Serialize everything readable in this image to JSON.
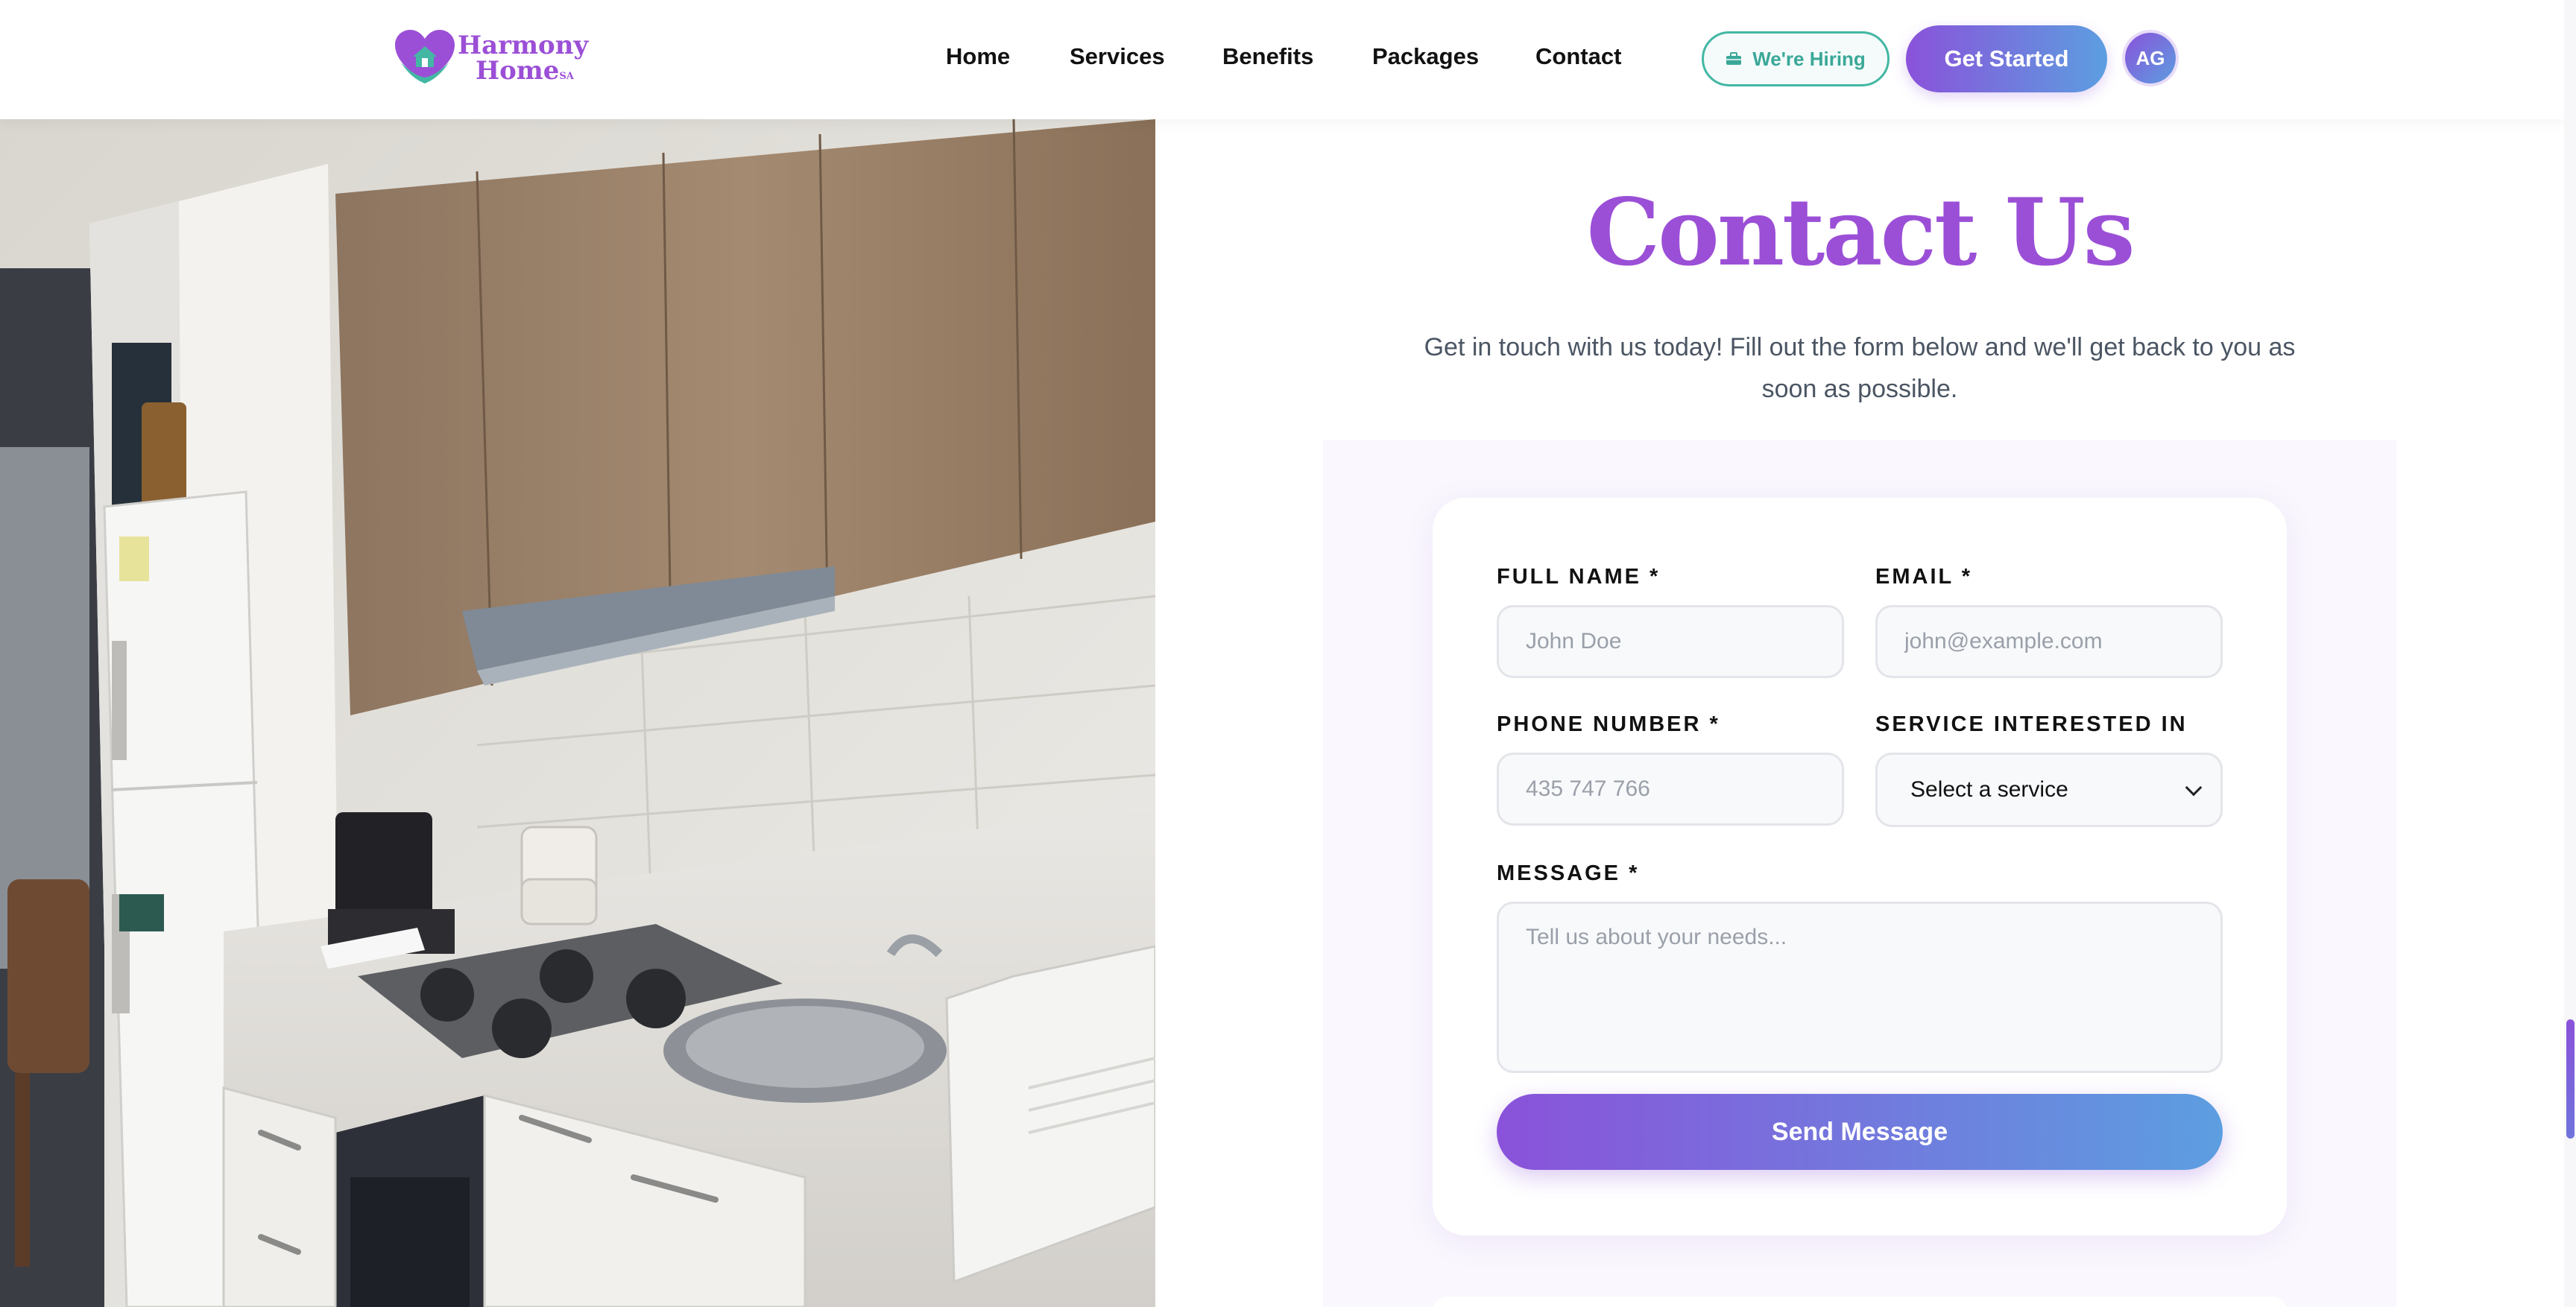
{
  "header": {
    "logo": {
      "line1": "Harmony",
      "line2": "Home",
      "suffix": "SA"
    },
    "nav": [
      {
        "label": "Home"
      },
      {
        "label": "Services"
      },
      {
        "label": "Benefits"
      },
      {
        "label": "Packages"
      },
      {
        "label": "Contact"
      }
    ],
    "hiring_label": "We're Hiring",
    "hiring_icon": "briefcase-icon",
    "get_started_label": "Get Started",
    "avatar_initials": "AG"
  },
  "contact": {
    "title": "Contact Us",
    "subtitle": "Get in touch with us today! Fill out the form below and we'll get back to you as soon as possible.",
    "form": {
      "full_name_label": "FULL NAME *",
      "full_name_placeholder": "John Doe",
      "email_label": "EMAIL *",
      "email_placeholder": "john@example.com",
      "phone_label": "PHONE NUMBER *",
      "phone_placeholder": "435 747 766",
      "service_label": "SERVICE INTERESTED IN",
      "service_selected": "Select a service",
      "message_label": "MESSAGE *",
      "message_placeholder": "Tell us about your needs...",
      "submit_label": "Send Message"
    }
  },
  "colors": {
    "brand_purple": "#9b4fd6",
    "gradient_start": "#8a52da",
    "gradient_end": "#5c9ee0",
    "teal": "#43b7a4"
  }
}
